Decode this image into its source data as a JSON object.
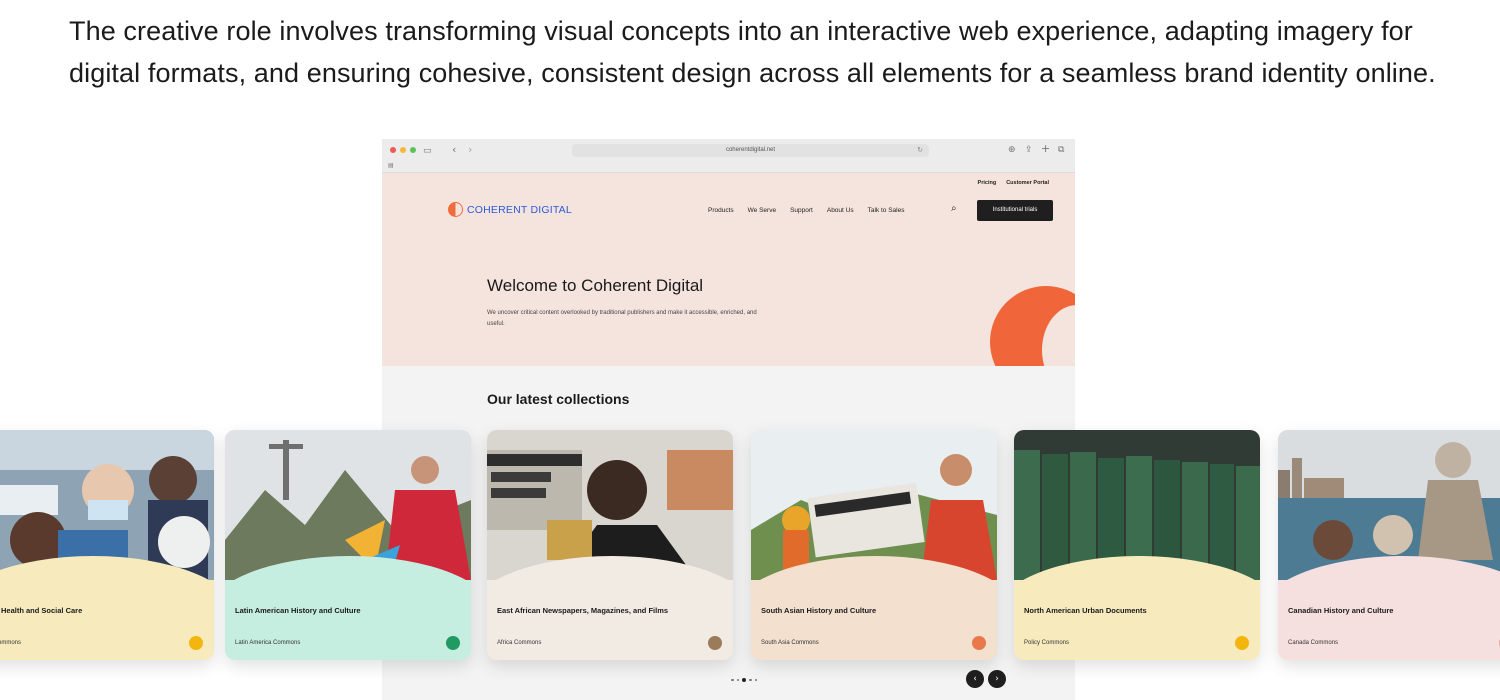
{
  "intro": {
    "text": "The creative role involves transforming visual concepts into an interactive web experience, adapting imagery for digital formats, and ensuring cohesive, consistent design across all elements for a seamless brand identity online."
  },
  "browser": {
    "url": "coherentdigital.net",
    "window_dots": [
      "#ee5b50",
      "#f5b937",
      "#5cc35a"
    ]
  },
  "site": {
    "top_links": [
      "Pricing",
      "Customer Portal"
    ],
    "logo_text": "COHERENT DIGITAL",
    "nav": [
      "Products",
      "We Serve",
      "Support",
      "About Us",
      "Talk to Sales"
    ],
    "cta": "Institutional trials",
    "hero": {
      "title": "Welcome to Coherent Digital",
      "text": "We uncover critical content overlooked by traditional publishers and make it accessible, enriched, and useful."
    },
    "collections_title": "Our latest collections"
  },
  "cards": [
    {
      "title": "Health and Social Care",
      "subtitle": "ommons",
      "color": "#f7ebbd",
      "badge": "#f2b60f"
    },
    {
      "title": "Latin American History and Culture",
      "subtitle": "Latin America Commons",
      "color": "#c6eee0",
      "badge": "#1f9a62"
    },
    {
      "title": "East African Newspapers, Magazines, and Films",
      "subtitle": "Africa Commons",
      "color": "#f2ebe3",
      "badge": "#9b7b5a"
    },
    {
      "title": "South Asian History and Culture",
      "subtitle": "South Asia Commons",
      "color": "#f3e0cf",
      "badge": "#e9784a"
    },
    {
      "title": "North American Urban Documents",
      "subtitle": "Policy Commons",
      "color": "#f7ebbd",
      "badge": "#f2b60f"
    },
    {
      "title": "Canadian History and Culture",
      "subtitle": "Canada Commons",
      "color": "#f6dfdf",
      "badge": "#f0a0a0"
    }
  ],
  "carousel": {
    "prev": "‹",
    "next": "›",
    "page_count": 5,
    "active_page": 3
  }
}
